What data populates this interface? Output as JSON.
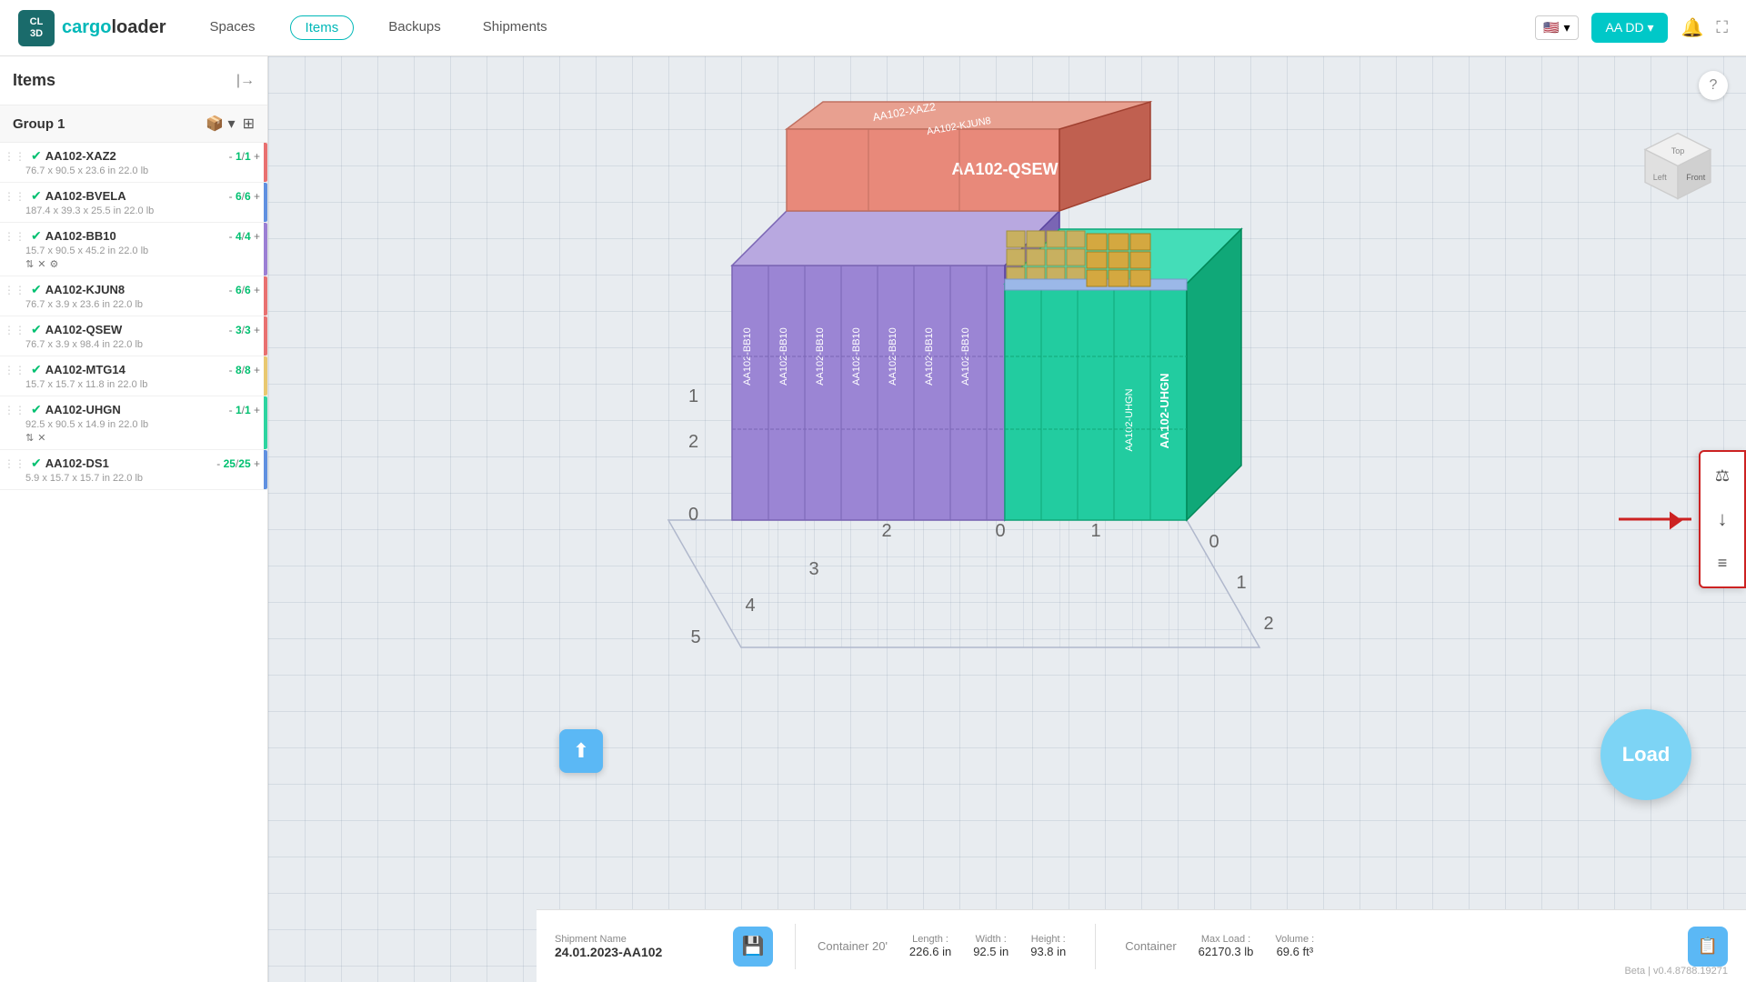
{
  "app": {
    "name": "cargoloader",
    "logo_line1": "CL",
    "logo_line2": "3D"
  },
  "navbar": {
    "links": [
      {
        "id": "spaces",
        "label": "Spaces",
        "active": false
      },
      {
        "id": "items",
        "label": "Items",
        "active": true
      },
      {
        "id": "backups",
        "label": "Backups",
        "active": false
      },
      {
        "id": "shipments",
        "label": "Shipments",
        "active": false
      }
    ],
    "user_btn": "AA DD",
    "flag": "🇺🇸"
  },
  "sidebar": {
    "title": "Items",
    "group_name": "Group 1",
    "items": [
      {
        "id": "AA102-XAZ2",
        "name": "AA102-XAZ2",
        "count_loaded": "1",
        "count_total": "1",
        "dims": "76.7 x 90.5 x 23.6 in 22.0 lb",
        "color": "#e87070",
        "icons": []
      },
      {
        "id": "AA102-BVELA",
        "name": "AA102-BVELA",
        "count_loaded": "6",
        "count_total": "6",
        "dims": "187.4 x 39.3 x 25.5 in 22.0 lb",
        "color": "#6090e0",
        "icons": []
      },
      {
        "id": "AA102-BB10",
        "name": "AA102-BB10",
        "count_loaded": "4",
        "count_total": "4",
        "dims": "15.7 x 90.5 x 45.2 in 22.0 lb",
        "color": "#9b7fd4",
        "icons": [
          "sort",
          "close",
          "settings"
        ]
      },
      {
        "id": "AA102-KJUN8",
        "name": "AA102-KJUN8",
        "count_loaded": "6",
        "count_total": "6",
        "dims": "76.7 x 3.9 x 23.6 in 22.0 lb",
        "color": "#e87070",
        "icons": []
      },
      {
        "id": "AA102-QSEW",
        "name": "AA102-QSEW",
        "count_loaded": "3",
        "count_total": "3",
        "dims": "76.7 x 3.9 x 98.4 in 22.0 lb",
        "color": "#e87070",
        "icons": []
      },
      {
        "id": "AA102-MTG14",
        "name": "AA102-MTG14",
        "count_loaded": "8",
        "count_total": "8",
        "dims": "15.7 x 15.7 x 11.8 in 22.0 lb",
        "color": "#e8c870",
        "icons": []
      },
      {
        "id": "AA102-UHGN",
        "name": "AA102-UHGN",
        "count_loaded": "1",
        "count_total": "1",
        "dims": "92.5 x 90.5 x 14.9 in 22.0 lb",
        "color": "#2dd4a0",
        "icons": [
          "sort",
          "close"
        ]
      },
      {
        "id": "AA102-DS1",
        "name": "AA102-DS1",
        "count_loaded": "25",
        "count_total": "25",
        "dims": "5.9 x 15.7 x 15.7 in 22.0 lb",
        "color": "#6090e0",
        "icons": []
      }
    ]
  },
  "status_bar": {
    "shipment_label": "Shipment Name",
    "shipment_name": "24.01.2023-AA102",
    "container_type": "Container 20'",
    "container_label": "Container",
    "length_label": "Length :",
    "length_val": "226.6 in",
    "width_label": "Width :",
    "width_val": "92.5 in",
    "height_label": "Height :",
    "height_val": "93.8 in",
    "maxload_label": "Max Load :",
    "maxload_val": "62170.3 lb",
    "volume_label": "Volume :",
    "volume_val": "69.6 ft³"
  },
  "buttons": {
    "load": "Load",
    "help": "?",
    "upload_icon": "⬆",
    "save_icon": "💾",
    "copy_icon": "📋"
  },
  "version": "Beta | v0.4.8788.19271",
  "right_panel": {
    "icon1": "⚖",
    "icon2": "↓",
    "icon3": "≡"
  },
  "ruler_labels": [
    "0",
    "1",
    "2",
    "3",
    "4",
    "5",
    "0",
    "1",
    "2"
  ],
  "cargo_items": [
    {
      "label": "AA102-XAZ2",
      "color": "#e8897a"
    },
    {
      "label": "AA102-KJUN8",
      "color": "#e8897a"
    },
    {
      "label": "AA102-QSEW",
      "color": "#e8897a"
    },
    {
      "label": "AA102-BB10",
      "color": "#9b7fd4"
    },
    {
      "label": "AA102-BB10",
      "color": "#9b7fd4"
    },
    {
      "label": "AA102-UHGN",
      "color": "#2dd4a0"
    },
    {
      "label": "AA102-DS1",
      "color": "#9bb8e8"
    }
  ]
}
